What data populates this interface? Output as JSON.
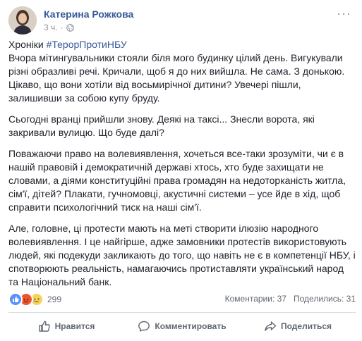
{
  "post": {
    "author": "Катерина Рожкова",
    "time": "3 ч.",
    "separator": "·",
    "more_glyph": "···",
    "intro_prefix": "Хроніки ",
    "hashtag": "#ТерорПротиНБУ",
    "paragraphs": [
      "Вчора мітингувальники стояли біля мого будинку цілий день. Вигукували різні образливі речі. Кричали, щоб я до них вийшла. Не сама. З донькою. Цікаво, що вони хотіли від восьмирічної дитини? Увечері пішли, залишивши за собою купу бруду.",
      "Сьогодні вранці прийшли знову. Деякі на таксі... Знесли ворота, які закривали вулицю. Що буде далі?",
      "Поважаючи право на волевиявлення, хочеться все-таки зрозуміти, чи є в нашій правовій і демократичній державі хтось, хто буде захищати не словами, а діями конституційні права громадян на недоторканість житла, сім'ї, дітей? Плакати, гучномовці, акустичні системи – усе йде в хід, щоб справити психологічний тиск на наші сім'ї.",
      "Але, головне, ці протести мають на меті створити ілюзію народного волевиявлення. І це найгірше, адже замовники протестів використовують людей, які подекуди закликають до того, що навіть не є в компетенції НБУ, і спотворюють реальність, намагаючись протиставляти український народ та Національний банк."
    ]
  },
  "stats": {
    "reactions_count": "299",
    "comments": "Коментарии: 37",
    "shares": "Поделились: 31",
    "colors": {
      "like": "#5890ff",
      "angry": "#f0552a",
      "sad": "#f7d358"
    }
  },
  "actions": {
    "like": "Нравится",
    "comment": "Комментировать",
    "share": "Поделиться"
  },
  "icons": {
    "avatar": "avatar",
    "globe": "globe-icon",
    "like": "thumbs-up-icon",
    "comment": "comment-icon",
    "share": "share-icon"
  }
}
